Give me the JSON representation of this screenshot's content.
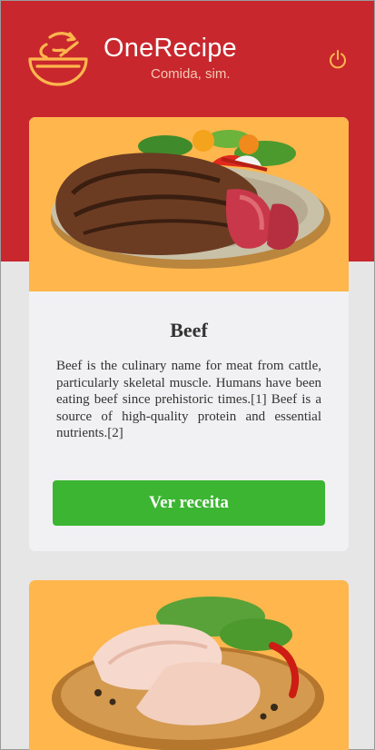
{
  "app": {
    "title": "OneRecipe",
    "subtitle": "Comida, sim.",
    "logo_icon": "bowl-icon",
    "power_icon": "power-icon"
  },
  "colors": {
    "header_red": "#c8272e",
    "icon_orange": "#ffb74d",
    "button_green": "#3cb532",
    "card_bg": "#f1f1f4",
    "page_bg": "#e6e6e6"
  },
  "recipes": [
    {
      "title": "Beef",
      "description": "Beef is the culinary name for meat from cattle, particularly skeletal muscle. Humans have been eating beef since prehistoric times.[1] Beef is a source of high-quality protein and essential nutrients.[2]",
      "button_label": "Ver receita",
      "image": "steak-plate-image"
    },
    {
      "title": "",
      "description": "",
      "button_label": "",
      "image": "chicken-board-image"
    }
  ]
}
